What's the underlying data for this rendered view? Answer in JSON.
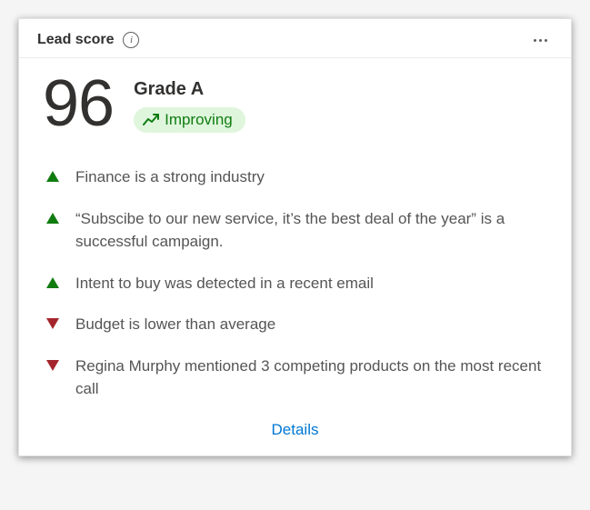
{
  "header": {
    "title": "Lead score",
    "info_icon_label": "i",
    "more_label": "More"
  },
  "score": {
    "value": "96",
    "grade": "Grade A",
    "trend": "Improving"
  },
  "reasons": [
    {
      "direction": "up",
      "text": "Finance is a strong industry"
    },
    {
      "direction": "up",
      "text": "“Subscibe to our new service, it’s the best deal of the year” is a successful campaign."
    },
    {
      "direction": "up",
      "text": "Intent to buy was detected in a recent email"
    },
    {
      "direction": "down",
      "text": "Budget is lower than average"
    },
    {
      "direction": "down",
      "text": "Regina Murphy mentioned 3 competing products on the most recent call"
    }
  ],
  "footer": {
    "details_label": "Details"
  }
}
